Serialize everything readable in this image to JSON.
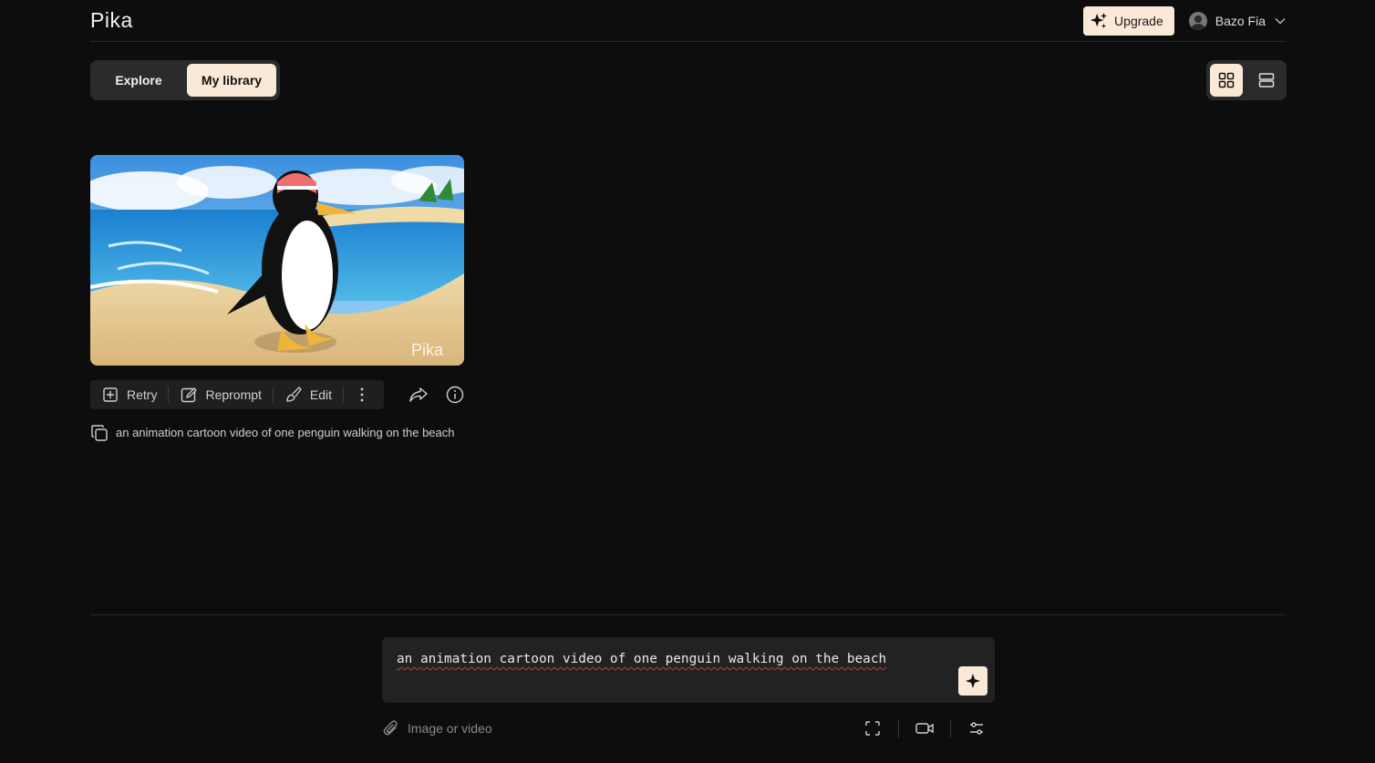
{
  "header": {
    "logo": "Pika",
    "upgrade_label": "Upgrade",
    "user_name": "Bazo Fia"
  },
  "tabs": [
    {
      "label": "Explore",
      "active": false
    },
    {
      "label": "My library",
      "active": true
    }
  ],
  "view_toggle": {
    "active": "grid",
    "options": [
      "grid-icon",
      "list-icon"
    ]
  },
  "card": {
    "watermark": "Pika",
    "actions": {
      "retry": "Retry",
      "reprompt": "Reprompt",
      "edit": "Edit"
    },
    "prompt": "an animation cartoon video of one penguin walking on the beach"
  },
  "composer": {
    "value": "an animation cartoon video of one penguin walking on the beach",
    "attach_label": "Image or video"
  },
  "colors": {
    "background": "#0d0d0d",
    "accent": "#fbe9d7",
    "panel": "#2b2b2b"
  }
}
